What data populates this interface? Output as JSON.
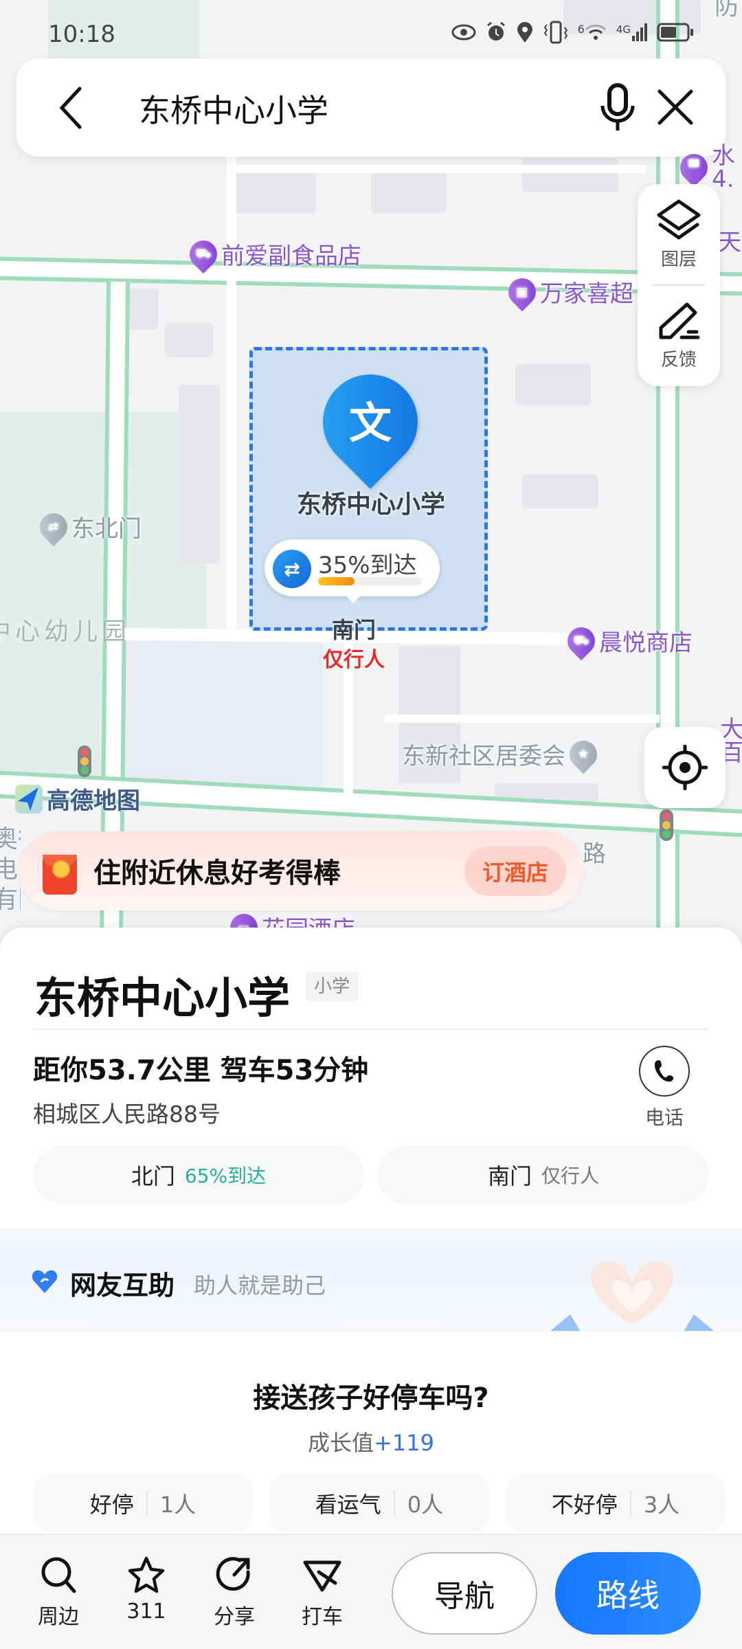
{
  "status_bar": {
    "time": "10:18",
    "icons": [
      "eye-icon",
      "alarm-icon",
      "location-icon",
      "vibrate-icon",
      "wifi-icon",
      "signal-4g-icon",
      "battery-icon"
    ],
    "wifi_label": "6",
    "network_label": "4G"
  },
  "search": {
    "query": "东桥中心小学",
    "back_icon": "chevron-left-icon",
    "mic_icon": "microphone-icon",
    "clear_icon": "close-icon"
  },
  "map": {
    "layer_panel": {
      "layers_label": "图层",
      "feedback_label": "反馈"
    },
    "pois": [
      {
        "name": "前爱副食品店",
        "icon": "cart-icon"
      },
      {
        "name": "万家喜超",
        "icon": "store-icon"
      },
      {
        "name": "水",
        "icon": "food-icon",
        "sub": "4."
      },
      {
        "name": "天"
      },
      {
        "name": "东北门",
        "icon": "gate-icon"
      },
      {
        "name": "晨悦商店",
        "icon": "cart-icon"
      },
      {
        "name": "东新社区居委会",
        "icon": "star-icon"
      },
      {
        "name": "大",
        "sub": "百"
      },
      {
        "name": "花园酒店",
        "icon": "hotel-icon"
      },
      {
        "name": "路"
      }
    ],
    "area_labels": [
      "中心幼儿园",
      "防平值班室",
      "奥得",
      "电",
      "有限"
    ],
    "selected": {
      "name": "东桥中心小学",
      "glyph": "文",
      "arrival_text": "35%到达",
      "arrival_percent": 35,
      "gate_name": "南门",
      "gate_note": "仅行人"
    },
    "logo_text": "高德地图"
  },
  "promo": {
    "text": "住附近休息好考得棒",
    "button": "订酒店"
  },
  "place": {
    "title": "东桥中心小学",
    "tag": "小学",
    "distance": "距你53.7公里  驾车53分钟",
    "address": "相城区人民路88号",
    "phone_label": "电话",
    "gates": [
      {
        "name": "北门",
        "note": "65%到达"
      },
      {
        "name": "南门",
        "note": "仅行人"
      }
    ]
  },
  "helper": {
    "title": "网友互助",
    "subtitle": "助人就是助己",
    "question": "接送孩子好停车吗?",
    "growth_label": "成长值",
    "growth_value": "+119",
    "votes": [
      {
        "label": "好停",
        "count": "1人"
      },
      {
        "label": "看运气",
        "count": "0人"
      },
      {
        "label": "不好停",
        "count": "3人"
      }
    ]
  },
  "bottom_bar": {
    "items": [
      {
        "label": "周边",
        "icon": "search-icon"
      },
      {
        "label": "311",
        "icon": "star-icon"
      },
      {
        "label": "分享",
        "icon": "share-icon"
      },
      {
        "label": "打车",
        "icon": "taxi-icon"
      }
    ],
    "navigate": "导航",
    "route": "路线"
  },
  "colors": {
    "accent_blue": "#1677ff",
    "fence_blue": "#2c77e8",
    "arrival_orange": "#f08a12",
    "gate_green": "#26b28f",
    "warning_red": "#e62b2b",
    "promo_orange": "#f05a2a",
    "poi_purple": "#8a56c9"
  }
}
